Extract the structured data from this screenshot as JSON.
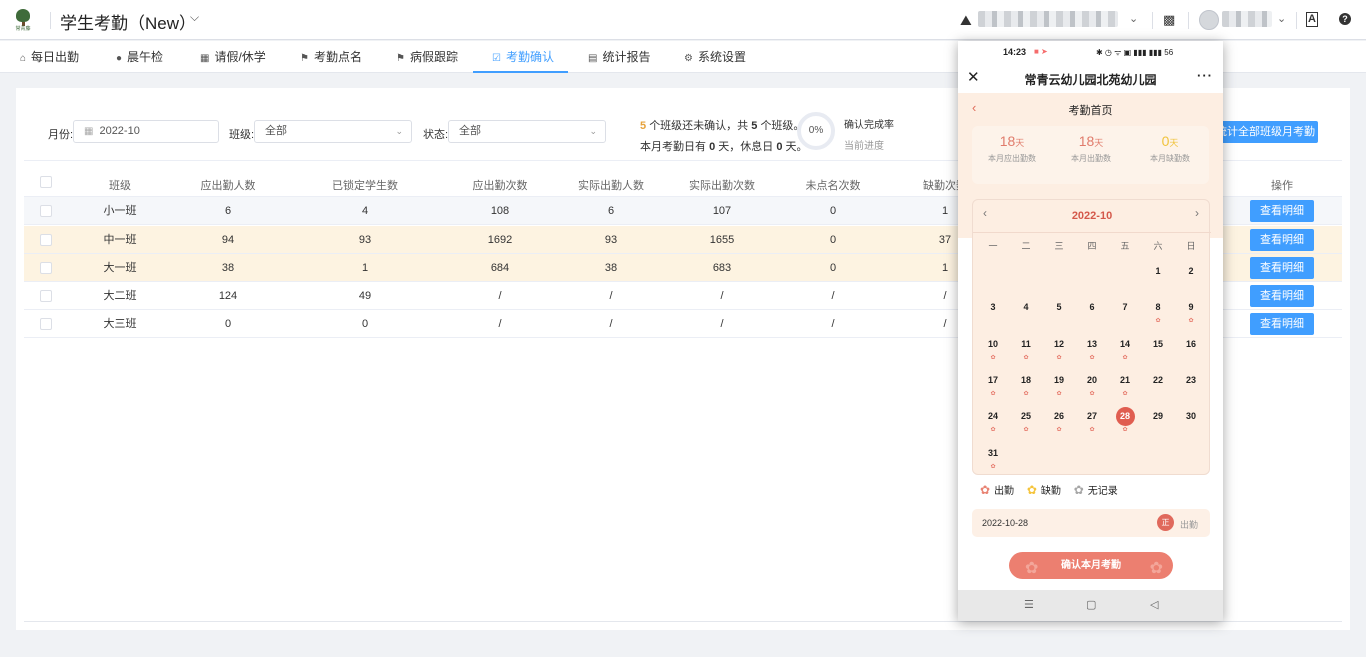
{
  "header": {
    "logo_text": "常青藤",
    "app_title": "学生考勤（New）",
    "help_icon": "question-icon"
  },
  "nav": {
    "tabs": [
      {
        "label": "每日出勤",
        "icon": "home-icon"
      },
      {
        "label": "晨午检",
        "icon": "pin-icon"
      },
      {
        "label": "请假/休学",
        "icon": "grid-icon"
      },
      {
        "label": "考勤点名",
        "icon": "flag-icon"
      },
      {
        "label": "病假跟踪",
        "icon": "flag-icon"
      },
      {
        "label": "考勤确认",
        "icon": "check-icon"
      },
      {
        "label": "统计报告",
        "icon": "chart-icon"
      },
      {
        "label": "系统设置",
        "icon": "gear-icon"
      }
    ],
    "active": "考勤确认"
  },
  "filters": {
    "month_label": "月份:",
    "month_value": "2022-10",
    "class_label": "班级:",
    "class_value": "全部",
    "status_label": "状态:",
    "status_value": "全部"
  },
  "summary": {
    "unconfirmed": "5",
    "line1_a": "个班级还未确认，共",
    "total": "5",
    "line1_b": "个班级。",
    "line2_a": "本月考勤日有",
    "work_days": "0",
    "line2_b": "天，休息日",
    "rest_days": "0",
    "line2_c": "天。",
    "rate_value": "0%",
    "rate_label": "确认完成率",
    "rate_sub": "当前进度",
    "export_button": "统计全部班级月考勤"
  },
  "table": {
    "headers": [
      "班级",
      "应出勤人数",
      "已锁定学生数",
      "应出勤次数",
      "实际出勤人数",
      "实际出勤次数",
      "未点名次数",
      "缺勤次数",
      "操作"
    ],
    "rows": [
      [
        "小一班",
        "6",
        "4",
        "108",
        "6",
        "107",
        "0",
        "1"
      ],
      [
        "中一班",
        "94",
        "93",
        "1692",
        "93",
        "1655",
        "0",
        "37"
      ],
      [
        "大一班",
        "38",
        "1",
        "684",
        "38",
        "683",
        "0",
        "1"
      ],
      [
        "大二班",
        "124",
        "49",
        "/",
        "/",
        "/",
        "/",
        "/"
      ],
      [
        "大三班",
        "0",
        "0",
        "/",
        "/",
        "/",
        "/",
        "/"
      ]
    ],
    "detail_button": "查看明细"
  },
  "phone": {
    "time": "14:23",
    "status_icons": "✱ ◷ ᯤ ▣ ▮▮▮ ▮▮▮ 56",
    "title": "常青云幼儿园北苑幼儿园",
    "subtitle": "考勤首页",
    "stats": [
      {
        "value": "18",
        "unit": "天",
        "label": "本月应出勤数"
      },
      {
        "value": "18",
        "unit": "天",
        "label": "本月出勤数"
      },
      {
        "value": "0",
        "unit": "天",
        "label": "本月缺勤数"
      }
    ],
    "calendar": {
      "month": "2022-10",
      "weekdays": [
        "一",
        "二",
        "三",
        "四",
        "五",
        "六",
        "日"
      ],
      "days": [
        {
          "d": "1",
          "paw": false
        },
        {
          "d": "2",
          "paw": false
        },
        {
          "d": "3",
          "paw": false
        },
        {
          "d": "4",
          "paw": false
        },
        {
          "d": "5",
          "paw": false
        },
        {
          "d": "6",
          "paw": false
        },
        {
          "d": "7",
          "paw": false
        },
        {
          "d": "8",
          "paw": true
        },
        {
          "d": "9",
          "paw": true
        },
        {
          "d": "10",
          "paw": true
        },
        {
          "d": "11",
          "paw": true
        },
        {
          "d": "12",
          "paw": true
        },
        {
          "d": "13",
          "paw": true
        },
        {
          "d": "14",
          "paw": true
        },
        {
          "d": "15",
          "paw": false
        },
        {
          "d": "16",
          "paw": false
        },
        {
          "d": "17",
          "paw": true
        },
        {
          "d": "18",
          "paw": true
        },
        {
          "d": "19",
          "paw": true
        },
        {
          "d": "20",
          "paw": true
        },
        {
          "d": "21",
          "paw": true
        },
        {
          "d": "22",
          "paw": false
        },
        {
          "d": "23",
          "paw": false
        },
        {
          "d": "24",
          "paw": true
        },
        {
          "d": "25",
          "paw": true
        },
        {
          "d": "26",
          "paw": true
        },
        {
          "d": "27",
          "paw": true
        },
        {
          "d": "28",
          "paw": true,
          "today": true
        },
        {
          "d": "29",
          "paw": false
        },
        {
          "d": "30",
          "paw": false
        },
        {
          "d": "31",
          "paw": true
        }
      ]
    },
    "legend": [
      "出勤",
      "缺勤",
      "无记录"
    ],
    "selected_date": "2022-10-28",
    "selected_badge": "正",
    "selected_status": "出勤",
    "confirm_button": "确认本月考勤"
  },
  "colors": {
    "primary": "#409eff",
    "highlight_row": "#fdf3e1",
    "phone_accent": "#e05d50",
    "peach": "#fdeee2"
  }
}
